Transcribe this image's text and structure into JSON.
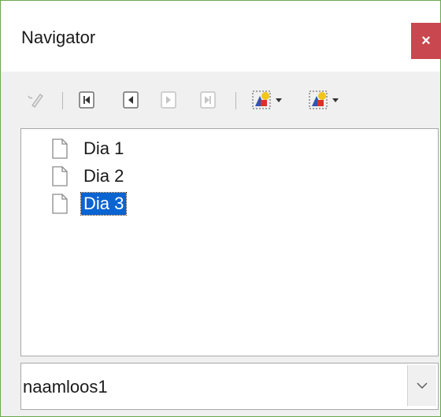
{
  "window": {
    "title": "Navigator",
    "close_label": "×"
  },
  "toolbar": {
    "buttons": [
      {
        "name": "edit-icon",
        "enabled": false
      },
      {
        "name": "first-slide-icon",
        "enabled": true
      },
      {
        "name": "previous-slide-icon",
        "enabled": true
      },
      {
        "name": "next-slide-icon",
        "enabled": false
      },
      {
        "name": "last-slide-icon",
        "enabled": false
      },
      {
        "name": "drag-mode-icon",
        "enabled": true
      },
      {
        "name": "shapes-icon",
        "enabled": true
      }
    ]
  },
  "tree": {
    "items": [
      {
        "label": "Dia 1",
        "selected": false,
        "icon": "document-icon"
      },
      {
        "label": "Dia 2",
        "selected": false,
        "icon": "document-icon"
      },
      {
        "label": "Dia 3",
        "selected": true,
        "icon": "document-icon"
      }
    ]
  },
  "document_select": {
    "value": "naamloos1",
    "icon": "chevron-down-icon"
  },
  "colors": {
    "close_bg": "#c9474e",
    "selection_bg": "#0a64d2",
    "frame_border": "#6aa84f"
  }
}
